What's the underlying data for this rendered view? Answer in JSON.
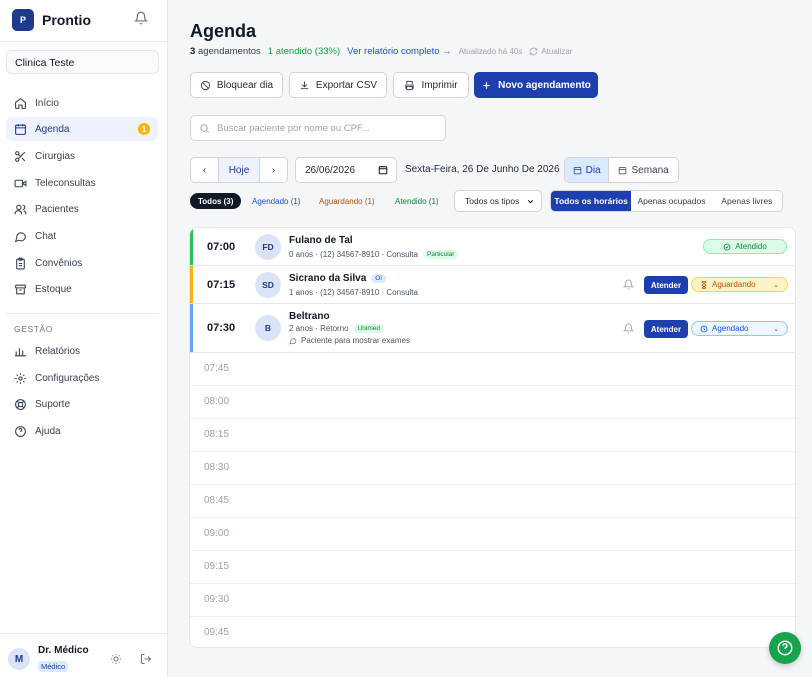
{
  "sidebar": {
    "brand": {
      "name": "Prontio",
      "logo_text": "P"
    },
    "clinic": "Clinica Teste",
    "items": [
      {
        "label": "Início",
        "icon": "home-icon"
      },
      {
        "label": "Agenda",
        "icon": "calendar-icon",
        "badge": "1"
      },
      {
        "label": "Cirurgias",
        "icon": "scissors-icon"
      },
      {
        "label": "Teleconsultas",
        "icon": "video-icon"
      },
      {
        "label": "Pacientes",
        "icon": "users-icon"
      },
      {
        "label": "Chat",
        "icon": "chat-icon"
      },
      {
        "label": "Convênios",
        "icon": "clipboard-icon"
      },
      {
        "label": "Estoque",
        "icon": "archive-icon"
      }
    ],
    "section_label": "GESTÃO",
    "manage_items": [
      {
        "label": "Relatórios",
        "icon": "bar-chart-icon"
      },
      {
        "label": "Configurações",
        "icon": "settings-icon"
      },
      {
        "label": "Suporte",
        "icon": "support-icon"
      },
      {
        "label": "Ajuda",
        "icon": "help-icon"
      }
    ],
    "user": {
      "initial": "M",
      "name": "Dr. Médico",
      "role": "Médico"
    }
  },
  "header": {
    "title": "Agenda",
    "summary": {
      "count": "3",
      "count_label": "agendamentos",
      "attended": "1 atendido (33%)",
      "report_link": "Ver relatório completo →",
      "updated": "Atualizado há 40s",
      "refresh": "Atualizar"
    }
  },
  "toolbar": {
    "block_day": "Bloquear dia",
    "export_csv": "Exportar CSV",
    "print": "Imprimir",
    "new_appointment": "Novo agendamento"
  },
  "search": {
    "placeholder": "Buscar paciente por nome ou CPF..."
  },
  "date_nav": {
    "prev": "‹",
    "today": "Hoje",
    "next": "›",
    "date_value": "26/06/2026",
    "date_label": "Sexta-Feira, 26 De Junho De 2026",
    "view_day": "Dia",
    "view_week": "Semana"
  },
  "filters": {
    "all": "Todos (3)",
    "scheduled": "Agendado (1)",
    "waiting": "Aguardando (1)",
    "attended": "Atendido (1)",
    "type_select": "Todos os tipos",
    "time_all": "Todos os horários",
    "time_busy": "Apenas ocupados",
    "time_free": "Apenas livres"
  },
  "appointments": [
    {
      "time": "07:00",
      "initials": "FD",
      "name": "Fulano de Tal",
      "meta": "0 anos · (12) 34567-8910 · Consulta",
      "tag": "Particular",
      "status": "Atendido",
      "color": "#22c55e"
    },
    {
      "time": "07:15",
      "initials": "SD",
      "name": "Sicrano da Silva",
      "name_tag": "Oi",
      "meta": "1 anos · (12) 34567-8910 · Consulta",
      "action": "Atender",
      "status": "Aguardando",
      "color": "#f5b50b"
    },
    {
      "time": "07:30",
      "initials": "B",
      "name": "Beltrano",
      "meta": "2 anos · Retorno",
      "tag": "Unimed",
      "note": "Paciente para mostrar exames",
      "action": "Atender",
      "status": "Agendado",
      "color": "#60a5fa"
    }
  ],
  "free_slots": [
    "07:45",
    "08:00",
    "08:15",
    "08:30",
    "08:45",
    "09:00",
    "09:15",
    "09:30",
    "09:45"
  ]
}
